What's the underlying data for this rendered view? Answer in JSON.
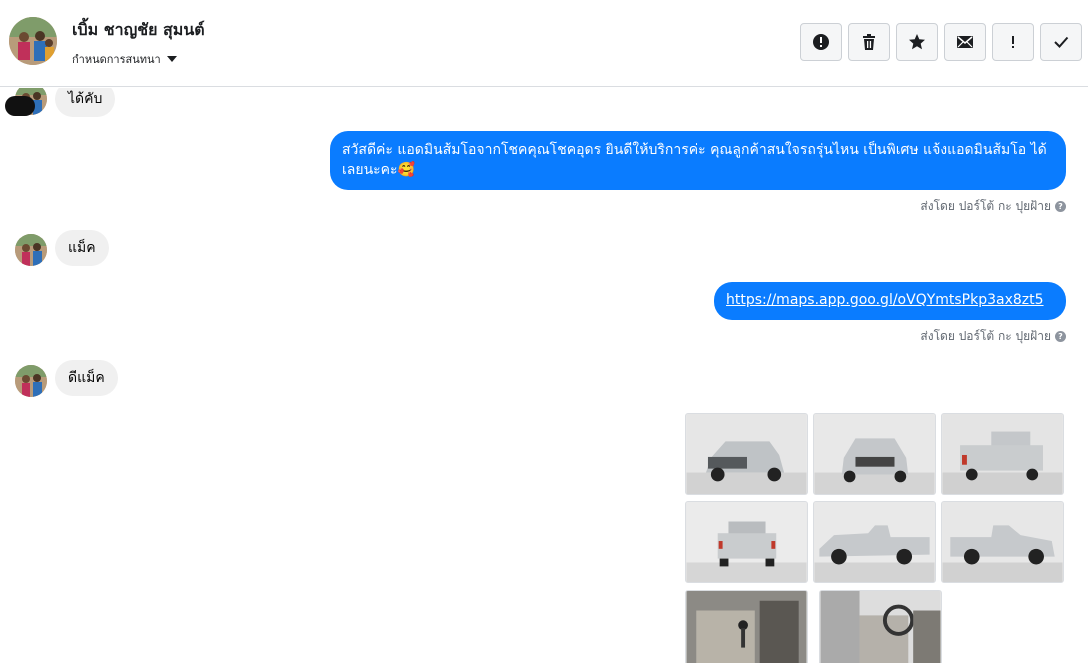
{
  "header": {
    "contact_name": "เบิ้ม ชาญชัย สุมนต์",
    "assign_label": "กำหนดการสนทนา"
  },
  "toolbar": [
    {
      "icon": "alert-circle-icon",
      "name": "mark-spam-button"
    },
    {
      "icon": "trash-icon",
      "name": "delete-button"
    },
    {
      "icon": "star-icon",
      "name": "star-button"
    },
    {
      "icon": "envelope-icon",
      "name": "mark-unread-button"
    },
    {
      "icon": "exclamation-icon",
      "name": "follow-up-button"
    },
    {
      "icon": "check-icon",
      "name": "mark-done-button"
    }
  ],
  "messages": {
    "m1": "ได้คับ",
    "m2": "สวัสดีค่ะ แอดมินส้มโอจากโชคคุณโชคอุดร ยินดีให้บริการค่ะ  คุณลูกค้าสนใจรถรุ่นไหน เป็นพิเศษ แจ้งแอดมินส้มโอ ได้เลยนะคะ🥰",
    "m2_sent_by": "ส่งโดย ปอร์โต้ กะ ปุยฝ้าย",
    "m3": "แม็ค",
    "m4": "https://maps.app.goo.gl/oVQYmtsPkp3ax8zt5",
    "m4_sent_by": "ส่งโดย ปอร์โต้ กะ ปุยฝ้าย",
    "m5": "ดีแม็ค"
  },
  "colors": {
    "outgoing_bubble": "#0a7cff",
    "incoming_bubble": "#f0f0f0"
  }
}
